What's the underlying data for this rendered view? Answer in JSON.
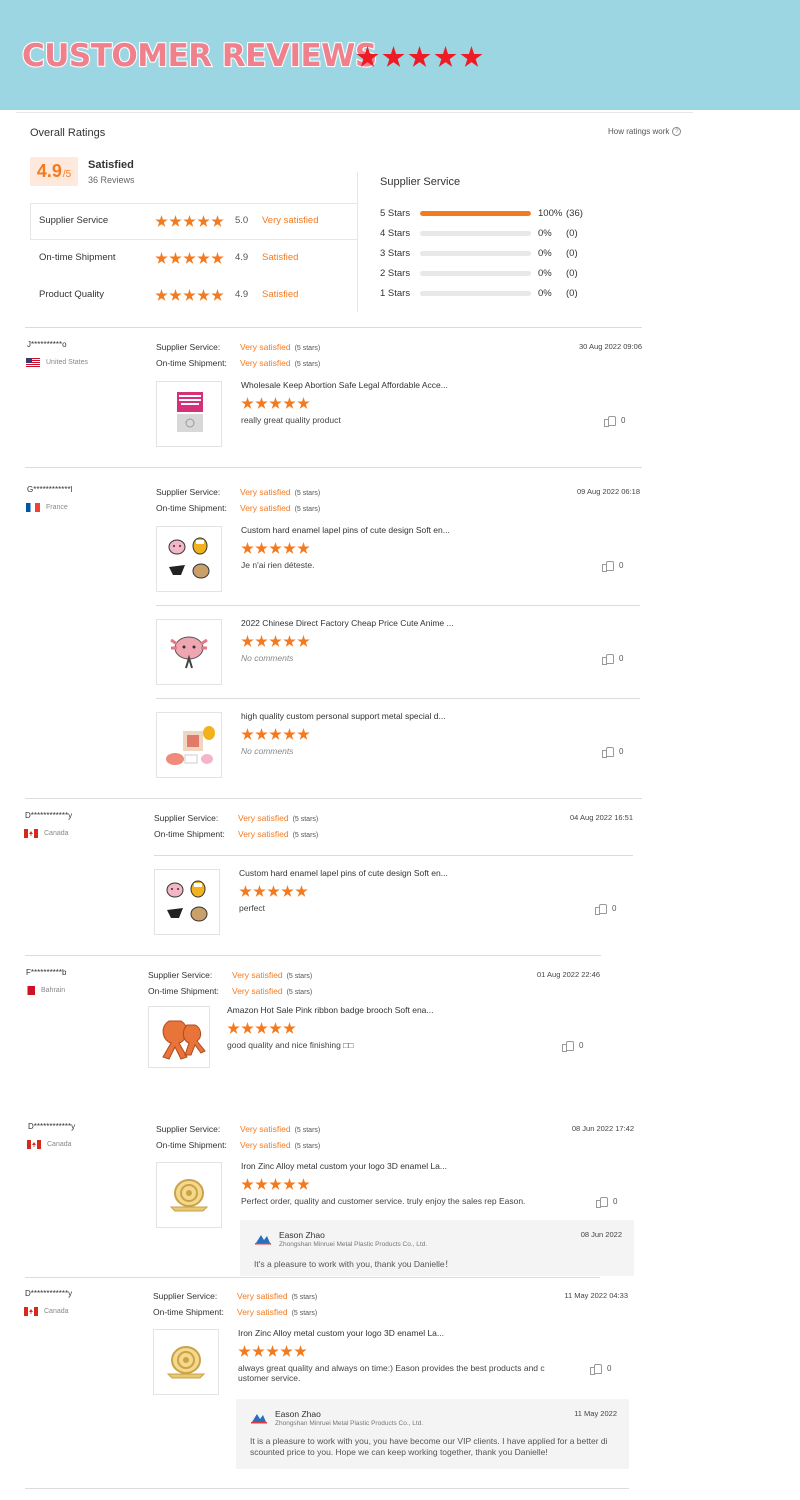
{
  "banner": {
    "title": "CUSTOMER REVIEWS",
    "star_count": 5,
    "star_color": "#ee1a24",
    "background": "#9bd6e2"
  },
  "overall": {
    "title": "Overall Ratings",
    "how_link": "How ratings work",
    "help_icon": "question-circle-icon",
    "score": "4.9",
    "score_max": "/5",
    "status": "Satisfied",
    "reviews_count": "36 Reviews"
  },
  "ratings": [
    {
      "label": "Supplier Service",
      "stars": 5,
      "value": "5.0",
      "status": "Very satisfied"
    },
    {
      "label": "On-time Shipment",
      "stars": 5,
      "value": "4.9",
      "status": "Satisfied"
    },
    {
      "label": "Product Quality",
      "stars": 5,
      "value": "4.9",
      "status": "Satisfied"
    }
  ],
  "distribution": {
    "title": "Supplier Service",
    "rows": [
      {
        "label": "5  Stars",
        "fraction": 1.0,
        "pct": "100%",
        "count": "(36)"
      },
      {
        "label": "4  Stars",
        "fraction": 0.0,
        "pct": "0%",
        "count": "(0)"
      },
      {
        "label": "3  Stars",
        "fraction": 0.0,
        "pct": "0%",
        "count": "(0)"
      },
      {
        "label": "2  Stars",
        "fraction": 0.0,
        "pct": "0%",
        "count": "(0)"
      },
      {
        "label": "1  Stars",
        "fraction": 0.0,
        "pct": "0%",
        "count": "(0)"
      }
    ]
  },
  "accent_color": "#f47a20",
  "labels": {
    "supplier_service": "Supplier Service:",
    "on_time": "On-time Shipment:",
    "very_satisfied": "Very satisfied",
    "five_stars": "(5 stars)"
  },
  "reviews": [
    {
      "user": "J**********o",
      "country": "United States",
      "flag": "us",
      "date": "30 Aug 2022 09:06",
      "products": [
        {
          "name": "Wholesale Keep Abortion Safe Legal Affordable Acce...",
          "stars": 5,
          "comment": "really great quality product",
          "likes": "0",
          "image": "pink-abortion-sign-pin"
        }
      ]
    },
    {
      "user": "G************l",
      "country": "France",
      "flag": "fr",
      "date": "09 Aug 2022 06:18",
      "products": [
        {
          "name": "Custom hard enamel lapel pins of cute design Soft en...",
          "stars": 5,
          "comment": "Je n'ai rien déteste.",
          "likes": "0",
          "image": "cute-animal-pins-set"
        },
        {
          "name": "2022 Chinese Direct Factory Cheap Price Cute Anime ...",
          "stars": 5,
          "comment": "No comments",
          "empty": true,
          "likes": "0",
          "image": "pink-axolotl-pin"
        },
        {
          "name": "high quality custom personal support metal special d...",
          "stars": 5,
          "comment": "No comments",
          "empty": true,
          "likes": "0",
          "image": "pins-with-packaging"
        }
      ]
    },
    {
      "user": "D************y",
      "country": "Canada",
      "flag": "ca",
      "date": "04 Aug 2022 16:51",
      "products": [
        {
          "name": "Custom hard enamel lapel pins of cute design Soft en...",
          "stars": 5,
          "comment": "perfect",
          "likes": "0",
          "image": "cute-animal-pins-set"
        }
      ]
    },
    {
      "user": "F**********b",
      "country": "Bahrain",
      "flag": "bh",
      "date": "01 Aug 2022 22:46",
      "products": [
        {
          "name": "Amazon Hot Sale Pink ribbon badge brooch Soft ena...",
          "stars": 5,
          "comment": "good quality and nice finishing □□",
          "likes": "0",
          "image": "orange-ribbon-pins"
        }
      ]
    },
    {
      "user": "D************y",
      "country": "Canada",
      "flag": "ca",
      "date": "08 Jun 2022 17:42",
      "products": [
        {
          "name": "Iron Zinc Alloy metal custom your logo 3D enamel La...",
          "stars": 5,
          "comment": "Perfect order, quality and customer service. truly enjoy the sales rep Eason.",
          "likes": "0",
          "image": "gold-snail-pin"
        }
      ],
      "reply": {
        "name": "Eason Zhao",
        "company": "Zhongshan Minruei Metal Plastic Products Co., Ltd.",
        "date": "08 Jun 2022",
        "text": "It's a pleasure to work with you, thank you Danielle！"
      }
    },
    {
      "user": "D************y",
      "country": "Canada",
      "flag": "ca",
      "date": "11 May 2022 04:33",
      "products": [
        {
          "name": "Iron Zinc Alloy metal custom your logo 3D enamel La...",
          "stars": 5,
          "comment": "always great quality and always on time:)  Eason provides the best products and c ustomer service.",
          "likes": "0",
          "image": "gold-snail-pin"
        }
      ],
      "reply": {
        "name": "Eason Zhao",
        "company": "Zhongshan Minruei Metal Plastic Products Co., Ltd.",
        "date": "11 May 2022",
        "text": "It is a pleasure to work with you, you have become our VIP clients. I have applied for a better di scounted price to you. Hope we can keep working together, thank you Danielle!"
      }
    }
  ]
}
